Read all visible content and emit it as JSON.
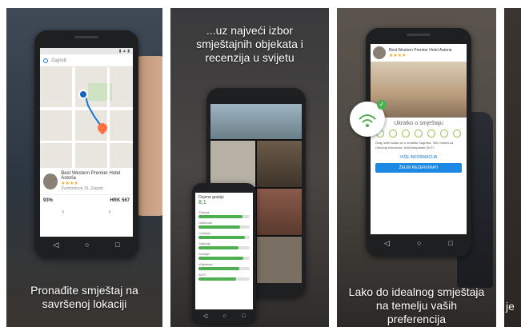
{
  "panels": [
    {
      "caption_lines": [
        "Pronađite smještaj na",
        "savršenoj lokaciji"
      ],
      "search_placeholder": "Zagreb",
      "hotel": {
        "name": "Best Western Premier Hotel Astoria",
        "stars": "★★★★",
        "address": "Zvonimirova 15, Zagreb",
        "rating_label": "93%",
        "price": "HRK 567"
      },
      "nav_arrows": [
        "‹",
        "›"
      ],
      "nav": [
        "◁",
        "○",
        "□"
      ]
    },
    {
      "caption_lines": [
        "...uz najveći izbor",
        "smještajnih objekata i",
        "recenzija u svijetu"
      ],
      "rating_title": "Ocjene gostiju",
      "rating_value": "8,1",
      "rating_rows": [
        {
          "label": "Čistoća",
          "value": 0.86
        },
        {
          "label": "Udobnost",
          "value": 0.82
        },
        {
          "label": "Lokacija",
          "value": 0.91
        },
        {
          "label": "Sadržaji",
          "value": 0.78
        },
        {
          "label": "Osoblje",
          "value": 0.88
        },
        {
          "label": "Vrijednost",
          "value": 0.8
        },
        {
          "label": "Wi-Fi",
          "value": 0.74
        }
      ],
      "nav": [
        "◁",
        "○",
        "□"
      ]
    },
    {
      "caption_lines": [
        "Lako do idealnog smještaja",
        "na temelju vaših",
        "preferencija"
      ],
      "hotel_name": "Best Western Premier Hotel Astoria",
      "hotel_stars": "★★★★",
      "about_title": "Ukratko o smještaju",
      "description": "Ovaj hotel nalazi se u središtu Zagreba, 300 metara od Glavnog kolodvora. Nudi besplatan Wi-Fi.",
      "info_link": "VIŠE INFORMACIJA",
      "book_label": "ŽELIM REZERVIRATI",
      "wifi_check": "✓",
      "nav": [
        "◁",
        "○",
        "□"
      ]
    },
    {
      "caption_fragment": "je"
    }
  ]
}
